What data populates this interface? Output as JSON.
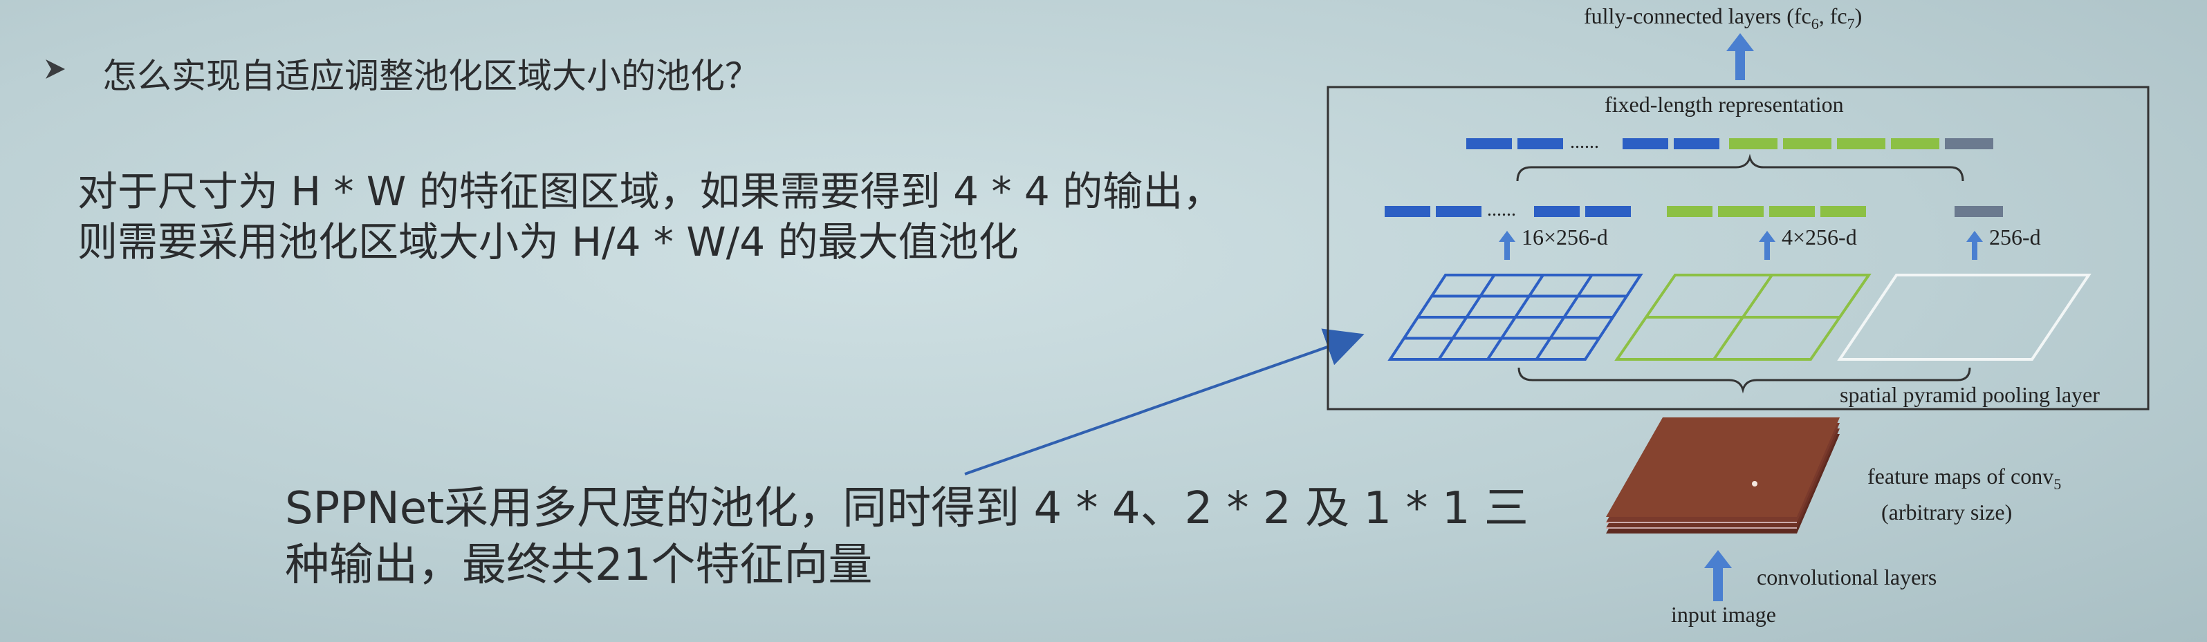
{
  "slide": {
    "bullet": "怎么实现自适应调整池化区域大小的池化？",
    "paragraph": [
      "对于尺寸为 H * W 的特征图区域，如果需要得到 4 * 4 的输出，",
      "则需要采用池化区域大小为 H/4 * W/4 的最大值池化"
    ],
    "note": [
      "SPPNet采用多尺度的池化，同时得到 4 * 4、2 * 2 及 1 * 1 三",
      "种输出，最终共21个特征向量"
    ]
  },
  "diagram": {
    "top_label": "fully-connected layers (fc",
    "top_label_sub1": "6",
    "top_label_mid": ", fc",
    "top_label_sub2": "7",
    "top_label_end": ")",
    "fixed_length": "fixed-length representation",
    "dim_16": "16×256-d",
    "dim_4": "4×256-d",
    "dim_1": "256-d",
    "spp_layer": "spatial pyramid pooling layer",
    "feature_maps_1": "feature maps of conv",
    "feature_maps_sub": "5",
    "feature_maps_2": "(arbitrary size)",
    "conv_layers": "convolutional layers",
    "input_image": "input image",
    "dots": "......"
  },
  "colors": {
    "blue": "#2c5fc4",
    "green": "#8cc044",
    "gray": "#6b7a8f",
    "feature_map": "#7a3a2c",
    "arrow": "#4a7fd0"
  }
}
